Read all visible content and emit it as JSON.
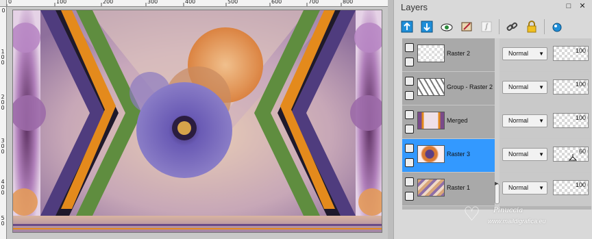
{
  "panel": {
    "title": "Layers",
    "buttons": {
      "maximize": "□",
      "close": "✕"
    },
    "toolbar_icons": [
      "new-layer-icon",
      "move-layer-down-icon",
      "visibility-icon",
      "edit-icon",
      "layer-style-icon",
      "link-icon",
      "lock-icon",
      "mask-icon"
    ]
  },
  "ruler": {
    "top_labels": [
      "0",
      "100",
      "200",
      "300",
      "400",
      "500",
      "600",
      "700",
      "800"
    ],
    "left_labels": [
      "0",
      "1 0 0",
      "2 0 0",
      "3 0 0",
      "4 0 0",
      "5 0"
    ]
  },
  "layers": [
    {
      "name": "Raster 2",
      "blend": "Normal",
      "opacity": "100",
      "selected": false
    },
    {
      "name": "Group - Raster 2",
      "blend": "Normal",
      "opacity": "100",
      "selected": false
    },
    {
      "name": "Merged",
      "blend": "Normal",
      "opacity": "100",
      "selected": false
    },
    {
      "name": "Raster 3",
      "blend": "Normal",
      "opacity": "60",
      "selected": true
    },
    {
      "name": "Raster 1",
      "blend": "Normal",
      "opacity": "100",
      "selected": false
    }
  ],
  "watermark": {
    "name": "Pinuccia",
    "url": "www.maildigrafica.eu"
  },
  "colors": {
    "selection": "#3399ff",
    "green_stripe": "#5f8d3f",
    "orange_stripe": "#e48a1c",
    "purple_stripe": "#5a3f84"
  }
}
